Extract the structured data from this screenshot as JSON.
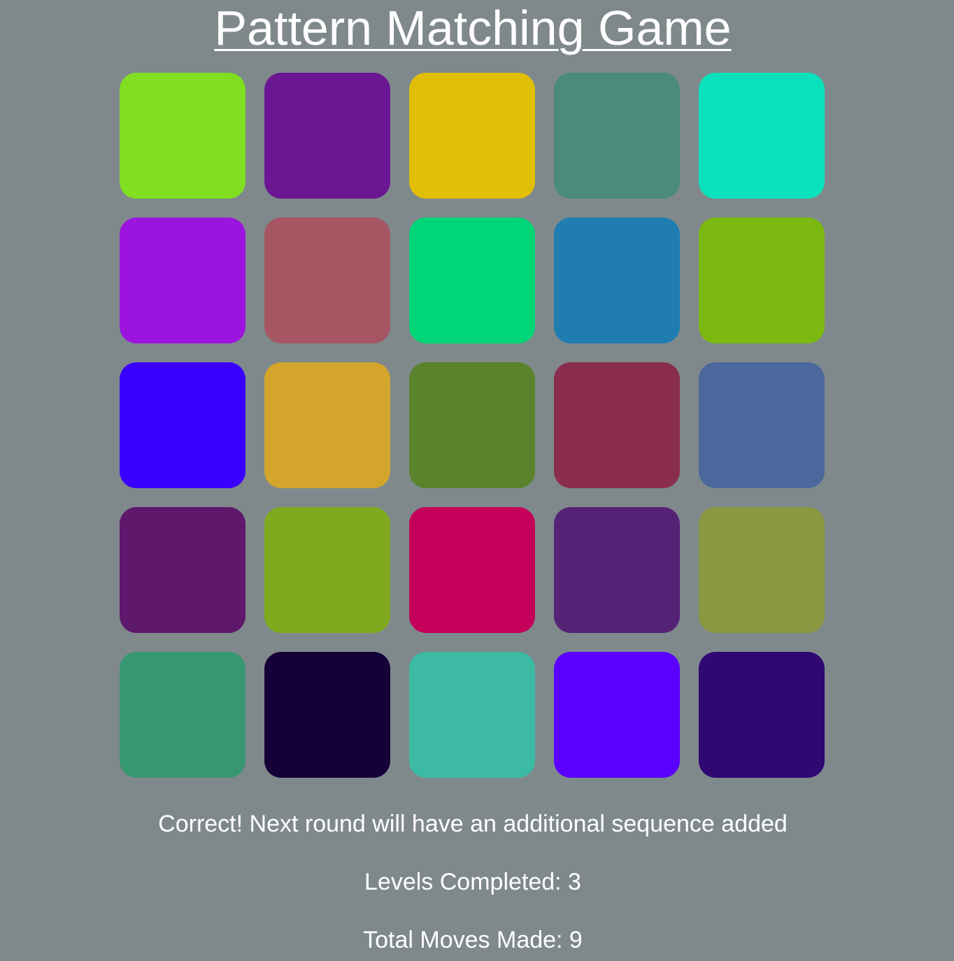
{
  "title": "Pattern Matching Game",
  "tiles": [
    {
      "color": "#7fdf20"
    },
    {
      "color": "#6b1793"
    },
    {
      "color": "#e0bf06"
    },
    {
      "color": "#4a8b7a"
    },
    {
      "color": "#0ce1bd"
    },
    {
      "color": "#9b15df"
    },
    {
      "color": "#a65662"
    },
    {
      "color": "#00d678"
    },
    {
      "color": "#1f7db2"
    },
    {
      "color": "#7cb910"
    },
    {
      "color": "#3a00ff"
    },
    {
      "color": "#d3a52b"
    },
    {
      "color": "#5a832b"
    },
    {
      "color": "#8b2d4d"
    },
    {
      "color": "#4b679b"
    },
    {
      "color": "#5e186c"
    },
    {
      "color": "#7faa1f"
    },
    {
      "color": "#c4005b"
    },
    {
      "color": "#552276"
    },
    {
      "color": "#899841"
    },
    {
      "color": "#379771"
    },
    {
      "color": "#150038"
    },
    {
      "color": "#3dbaa3"
    },
    {
      "color": "#5900ff"
    },
    {
      "color": "#2f0872"
    }
  ],
  "status_message": "Correct! Next round will have an additional sequence added",
  "levels_completed": "Levels Completed: 3",
  "total_moves": "Total Moves Made: 9"
}
